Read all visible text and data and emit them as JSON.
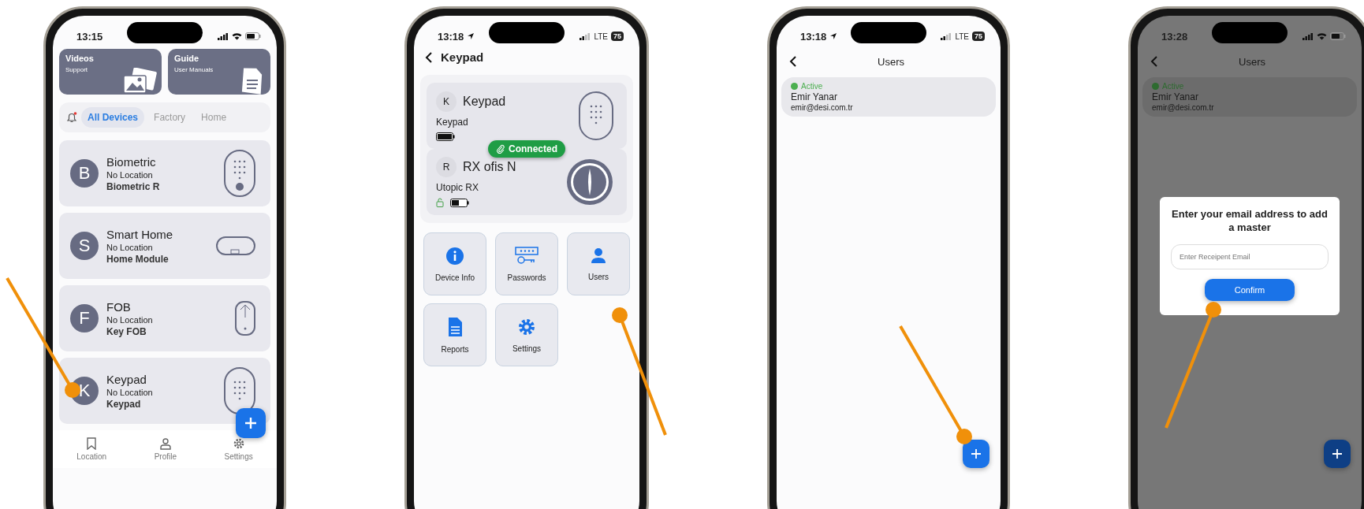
{
  "screens": [
    {
      "kind": "devices",
      "status_bar": {
        "time": "13:15"
      },
      "shortcuts": [
        {
          "title": "Videos",
          "subtitle": "Support",
          "kind": "photos"
        },
        {
          "title": "Guide",
          "subtitle": "User Manuals",
          "kind": "document"
        }
      ],
      "tabs": [
        {
          "label": "All Devices",
          "selected": true
        },
        {
          "label": "Factory",
          "selected": false
        },
        {
          "label": "Home",
          "selected": false
        }
      ],
      "devices": [
        {
          "initial": "B",
          "name": "Biometric",
          "location": "No Location",
          "model": "Biometric R",
          "kind": "biometric"
        },
        {
          "initial": "S",
          "name": "Smart Home",
          "location": "No Location",
          "model": "Home Module",
          "kind": "module"
        },
        {
          "initial": "F",
          "name": "FOB",
          "location": "No Location",
          "model": "Key FOB",
          "kind": "fob"
        },
        {
          "initial": "K",
          "name": "Keypad",
          "location": "No Location",
          "model": "Keypad",
          "kind": "keypad"
        }
      ],
      "nav": [
        {
          "label": "Location",
          "kind": "bookmark"
        },
        {
          "label": "Profile",
          "kind": "person"
        },
        {
          "label": "Settings",
          "kind": "gear"
        }
      ]
    },
    {
      "kind": "detail",
      "status_bar": {
        "time": "13:18",
        "location_arrow": true,
        "network": "LTE",
        "battery": "75"
      },
      "title": "Keypad",
      "devices": [
        {
          "initial": "K",
          "name": "Keypad",
          "model": "Keypad",
          "kind": "keypad"
        },
        {
          "initial": "R",
          "name": "RX ofis N",
          "model": "Utopic RX",
          "kind": "lock"
        }
      ],
      "connection": "Connected",
      "actions": [
        {
          "label": "Device Info",
          "kind": "info"
        },
        {
          "label": "Passwords",
          "kind": "password"
        },
        {
          "label": "Users",
          "kind": "user"
        },
        {
          "label": "Reports",
          "kind": "report"
        },
        {
          "label": "Settings",
          "kind": "gear"
        }
      ]
    },
    {
      "kind": "users",
      "status_bar": {
        "time": "13:18",
        "location_arrow": true,
        "network": "LTE",
        "battery": "75"
      },
      "title": "Users",
      "users": [
        {
          "status": "Active",
          "name": "Emir Yanar",
          "email": "emir@desi.com.tr",
          "color": "#4caf50"
        }
      ]
    },
    {
      "kind": "users",
      "status_bar": {
        "time": "13:28"
      },
      "title": "Users",
      "users": [
        {
          "status": "Active",
          "name": "Emir Yanar",
          "email": "emir@desi.com.tr",
          "color": "#2e6b30"
        }
      ],
      "dialog": {
        "title": "Enter your email address to add a master",
        "placeholder": "Enter Receipent Email",
        "button": "Confirm"
      }
    }
  ]
}
